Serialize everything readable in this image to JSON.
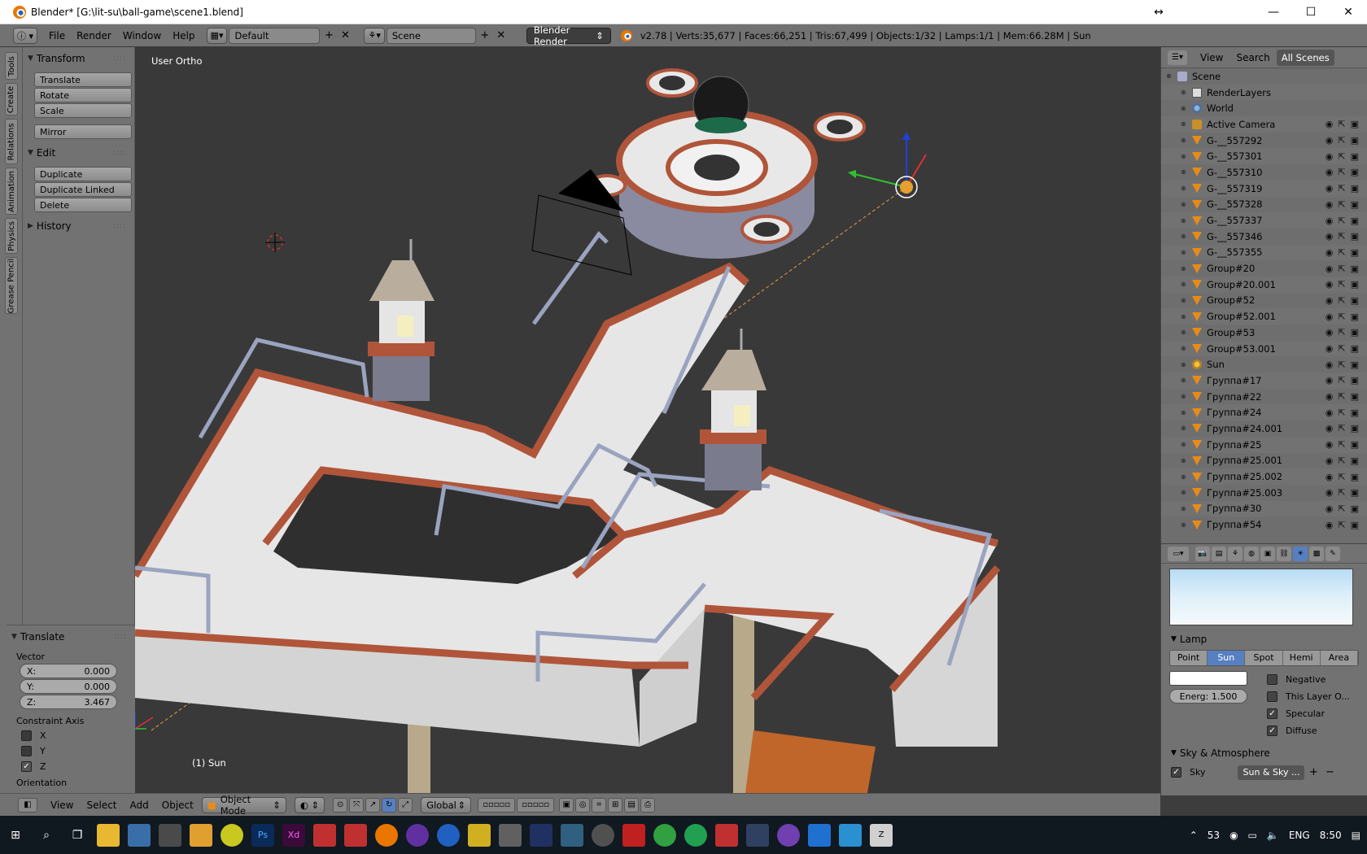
{
  "window": {
    "title": "Blender* [G:\\lit-su\\ball-game\\scene1.blend]"
  },
  "topbar": {
    "menus": [
      "File",
      "Render",
      "Window",
      "Help"
    ],
    "screen_layout": "Default",
    "scene": "Scene",
    "render_engine": "Blender Render",
    "stats": "v2.78 | Verts:35,677 | Faces:66,251 | Tris:67,499 | Objects:1/32 | Lamps:1/1 | Mem:66.28M | Sun"
  },
  "left_tabs": [
    "Tools",
    "Create",
    "Relations",
    "Animation",
    "Physics",
    "Grease Pencil"
  ],
  "toolshelf": {
    "transform_title": "Transform",
    "transform_buttons": [
      "Translate",
      "Rotate",
      "Scale"
    ],
    "mirror": "Mirror",
    "edit_title": "Edit",
    "edit_buttons": [
      "Duplicate",
      "Duplicate Linked",
      "Delete"
    ],
    "history_title": "History"
  },
  "operator": {
    "title": "Translate",
    "vector_label": "Vector",
    "x_label": "X:",
    "x": "0.000",
    "y_label": "Y:",
    "y": "0.000",
    "z_label": "Z:",
    "z": "3.467",
    "constraint_label": "Constraint Axis",
    "axes": [
      {
        "label": "X",
        "checked": false
      },
      {
        "label": "Y",
        "checked": false
      },
      {
        "label": "Z",
        "checked": true
      }
    ],
    "orientation_label": "Orientation"
  },
  "viewport": {
    "view_label": "User Ortho",
    "object_label": "(1) Sun"
  },
  "viewport_header": {
    "menus": [
      "View",
      "Select",
      "Add",
      "Object"
    ],
    "mode": "Object Mode",
    "orientation": "Global"
  },
  "outliner": {
    "menus": [
      "View",
      "Search"
    ],
    "filter": "All Scenes",
    "rows": [
      {
        "name": "Scene",
        "icon": "scene-icon",
        "indent": 0
      },
      {
        "name": "RenderLayers",
        "icon": "renderlayers-icon",
        "indent": 1
      },
      {
        "name": "World",
        "icon": "world-icon",
        "indent": 1
      },
      {
        "name": "Active Camera",
        "icon": "camera-icon",
        "indent": 1
      },
      {
        "name": "G-__557292",
        "icon": "mesh-icon",
        "indent": 1
      },
      {
        "name": "G-__557301",
        "icon": "mesh-icon",
        "indent": 1
      },
      {
        "name": "G-__557310",
        "icon": "mesh-icon",
        "indent": 1
      },
      {
        "name": "G-__557319",
        "icon": "mesh-icon",
        "indent": 1
      },
      {
        "name": "G-__557328",
        "icon": "mesh-icon",
        "indent": 1
      },
      {
        "name": "G-__557337",
        "icon": "mesh-icon",
        "indent": 1
      },
      {
        "name": "G-__557346",
        "icon": "mesh-icon",
        "indent": 1
      },
      {
        "name": "G-__557355",
        "icon": "mesh-icon",
        "indent": 1
      },
      {
        "name": "Group#20",
        "icon": "mesh-icon",
        "indent": 1
      },
      {
        "name": "Group#20.001",
        "icon": "mesh-icon",
        "indent": 1
      },
      {
        "name": "Group#52",
        "icon": "mesh-icon",
        "indent": 1
      },
      {
        "name": "Group#52.001",
        "icon": "mesh-icon",
        "indent": 1
      },
      {
        "name": "Group#53",
        "icon": "mesh-icon",
        "indent": 1
      },
      {
        "name": "Group#53.001",
        "icon": "mesh-icon",
        "indent": 1
      },
      {
        "name": "Sun",
        "icon": "sun-lamp-icon",
        "indent": 1
      },
      {
        "name": "Группа#17",
        "icon": "mesh-icon",
        "indent": 1
      },
      {
        "name": "Группа#22",
        "icon": "mesh-icon",
        "indent": 1
      },
      {
        "name": "Группа#24",
        "icon": "mesh-icon",
        "indent": 1
      },
      {
        "name": "Группа#24.001",
        "icon": "mesh-icon",
        "indent": 1
      },
      {
        "name": "Группа#25",
        "icon": "mesh-icon",
        "indent": 1
      },
      {
        "name": "Группа#25.001",
        "icon": "mesh-icon",
        "indent": 1
      },
      {
        "name": "Группа#25.002",
        "icon": "mesh-icon",
        "indent": 1
      },
      {
        "name": "Группа#25.003",
        "icon": "mesh-icon",
        "indent": 1
      },
      {
        "name": "Группа#30",
        "icon": "mesh-icon",
        "indent": 1
      },
      {
        "name": "Группа#54",
        "icon": "mesh-icon",
        "indent": 1
      }
    ]
  },
  "properties": {
    "lamp_title": "Lamp",
    "lamp_types": [
      "Point",
      "Sun",
      "Spot",
      "Hemi",
      "Area"
    ],
    "selected_type": "Sun",
    "energy": "Energ:  1.500",
    "checks": [
      {
        "label": "Negative",
        "checked": false
      },
      {
        "label": "This Layer O...",
        "checked": false
      },
      {
        "label": "Specular",
        "checked": true
      },
      {
        "label": "Diffuse",
        "checked": true
      }
    ],
    "sky_title": "Sky & Atmosphere",
    "sky_label": "Sky",
    "sky_preset": "Sun & Sky ..."
  },
  "taskbar": {
    "tray": {
      "count": "53",
      "lang": "ENG",
      "time": "8:50"
    }
  },
  "colors": {
    "accent": "#5680c2",
    "lamp_orange": "#e88a1a"
  }
}
